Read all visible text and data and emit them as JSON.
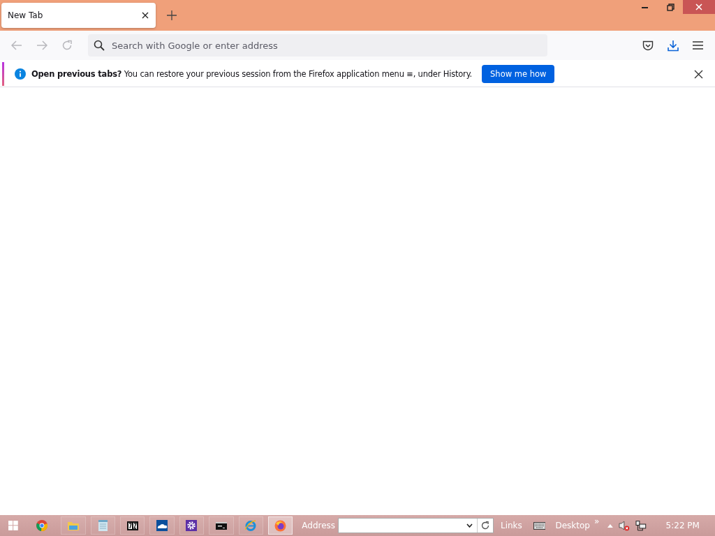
{
  "window": {
    "tabs": [
      {
        "title": "New Tab",
        "selected": true
      }
    ]
  },
  "toolbar": {
    "back_disabled": true,
    "forward_disabled": true,
    "address": {
      "placeholder": "Search with Google or enter address"
    }
  },
  "notification": {
    "message": "**Open previous tabs?** You can restore your previous session from the Firefox application menu ≡, under History.",
    "button": "Show me how"
  },
  "taskbar": {
    "apps": [
      {
        "kind": "chrome",
        "selected": false
      },
      {
        "kind": "explorer",
        "selected": false
      },
      {
        "kind": "notepad",
        "selected": false
      },
      {
        "kind": "archiver",
        "selected": false
      },
      {
        "kind": "cloud",
        "selected": false
      },
      {
        "kind": "settings",
        "selected": false
      },
      {
        "kind": "terminal",
        "selected": false
      },
      {
        "kind": "ie",
        "selected": false
      },
      {
        "kind": "firefox",
        "selected": true
      }
    ],
    "address_label": "Address",
    "links_label": "Links",
    "desktop_label": "Desktop",
    "chevron": "»",
    "clock": "5:22 PM"
  }
}
